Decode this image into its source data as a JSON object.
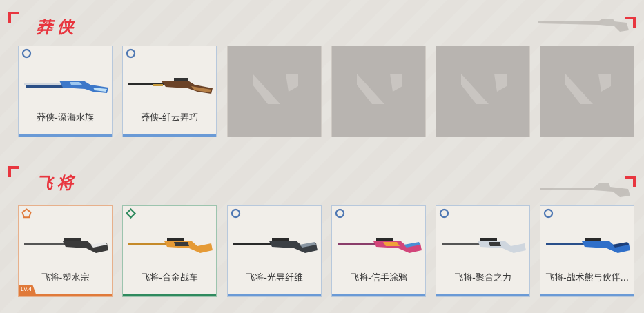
{
  "sections": [
    {
      "title": "莽侠",
      "cards": [
        {
          "name": "莽侠-深海水族",
          "rarity": "circle",
          "color": "#6a9ad6"
        },
        {
          "name": "莽侠-纤云弄巧",
          "rarity": "circle",
          "color": "#6a9ad6"
        }
      ],
      "empty_slots": 4
    },
    {
      "title": "飞将",
      "cards": [
        {
          "name": "飞将-塑水宗",
          "rarity": "pentagon",
          "color": "#e07a3a",
          "level": "Lv.4"
        },
        {
          "name": "飞将-合金战车",
          "rarity": "diamond",
          "color": "#2f8a5e"
        },
        {
          "name": "飞将-光导纤维",
          "rarity": "circle",
          "color": "#6a9ad6"
        },
        {
          "name": "飞将-信手涂鸦",
          "rarity": "circle",
          "color": "#6a9ad6"
        },
        {
          "name": "飞将-聚合之力",
          "rarity": "circle",
          "color": "#6a9ad6"
        },
        {
          "name": "飞将-战术熊与伙伴...",
          "rarity": "circle",
          "color": "#6a9ad6"
        }
      ]
    }
  ],
  "colors": {
    "accent": "#e8363f",
    "blue": "#6a9ad6",
    "green": "#2f8a5e",
    "orange": "#e07a3a"
  },
  "icons": {
    "rarity_circle": "ring-icon",
    "rarity_diamond": "diamond-icon",
    "rarity_pentagon": "pentagon-icon",
    "empty_slot": "valorant-v-logo-icon"
  }
}
